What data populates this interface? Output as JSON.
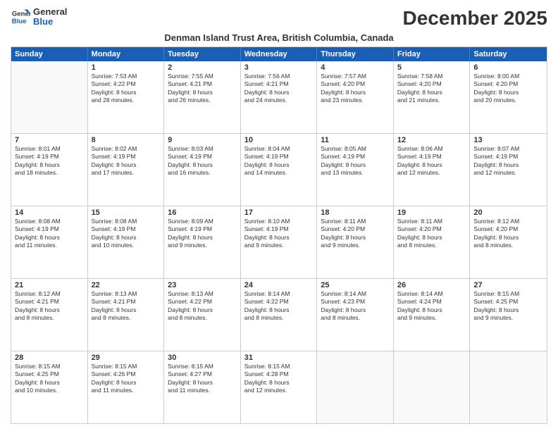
{
  "logo": {
    "line1": "General",
    "line2": "Blue"
  },
  "title": "December 2025",
  "subtitle": "Denman Island Trust Area, British Columbia, Canada",
  "header_days": [
    "Sunday",
    "Monday",
    "Tuesday",
    "Wednesday",
    "Thursday",
    "Friday",
    "Saturday"
  ],
  "weeks": [
    [
      {
        "day": "",
        "info": ""
      },
      {
        "day": "1",
        "info": "Sunrise: 7:53 AM\nSunset: 4:22 PM\nDaylight: 8 hours\nand 28 minutes."
      },
      {
        "day": "2",
        "info": "Sunrise: 7:55 AM\nSunset: 4:21 PM\nDaylight: 8 hours\nand 26 minutes."
      },
      {
        "day": "3",
        "info": "Sunrise: 7:56 AM\nSunset: 4:21 PM\nDaylight: 8 hours\nand 24 minutes."
      },
      {
        "day": "4",
        "info": "Sunrise: 7:57 AM\nSunset: 4:20 PM\nDaylight: 8 hours\nand 23 minutes."
      },
      {
        "day": "5",
        "info": "Sunrise: 7:58 AM\nSunset: 4:20 PM\nDaylight: 8 hours\nand 21 minutes."
      },
      {
        "day": "6",
        "info": "Sunrise: 8:00 AM\nSunset: 4:20 PM\nDaylight: 8 hours\nand 20 minutes."
      }
    ],
    [
      {
        "day": "7",
        "info": "Sunrise: 8:01 AM\nSunset: 4:19 PM\nDaylight: 8 hours\nand 18 minutes."
      },
      {
        "day": "8",
        "info": "Sunrise: 8:02 AM\nSunset: 4:19 PM\nDaylight: 8 hours\nand 17 minutes."
      },
      {
        "day": "9",
        "info": "Sunrise: 8:03 AM\nSunset: 4:19 PM\nDaylight: 8 hours\nand 16 minutes."
      },
      {
        "day": "10",
        "info": "Sunrise: 8:04 AM\nSunset: 4:19 PM\nDaylight: 8 hours\nand 14 minutes."
      },
      {
        "day": "11",
        "info": "Sunrise: 8:05 AM\nSunset: 4:19 PM\nDaylight: 8 hours\nand 13 minutes."
      },
      {
        "day": "12",
        "info": "Sunrise: 8:06 AM\nSunset: 4:19 PM\nDaylight: 8 hours\nand 12 minutes."
      },
      {
        "day": "13",
        "info": "Sunrise: 8:07 AM\nSunset: 4:19 PM\nDaylight: 8 hours\nand 12 minutes."
      }
    ],
    [
      {
        "day": "14",
        "info": "Sunrise: 8:08 AM\nSunset: 4:19 PM\nDaylight: 8 hours\nand 11 minutes."
      },
      {
        "day": "15",
        "info": "Sunrise: 8:08 AM\nSunset: 4:19 PM\nDaylight: 8 hours\nand 10 minutes."
      },
      {
        "day": "16",
        "info": "Sunrise: 8:09 AM\nSunset: 4:19 PM\nDaylight: 8 hours\nand 9 minutes."
      },
      {
        "day": "17",
        "info": "Sunrise: 8:10 AM\nSunset: 4:19 PM\nDaylight: 8 hours\nand 9 minutes."
      },
      {
        "day": "18",
        "info": "Sunrise: 8:11 AM\nSunset: 4:20 PM\nDaylight: 8 hours\nand 9 minutes."
      },
      {
        "day": "19",
        "info": "Sunrise: 8:11 AM\nSunset: 4:20 PM\nDaylight: 8 hours\nand 8 minutes."
      },
      {
        "day": "20",
        "info": "Sunrise: 8:12 AM\nSunset: 4:20 PM\nDaylight: 8 hours\nand 8 minutes."
      }
    ],
    [
      {
        "day": "21",
        "info": "Sunrise: 8:12 AM\nSunset: 4:21 PM\nDaylight: 8 hours\nand 8 minutes."
      },
      {
        "day": "22",
        "info": "Sunrise: 8:13 AM\nSunset: 4:21 PM\nDaylight: 8 hours\nand 8 minutes."
      },
      {
        "day": "23",
        "info": "Sunrise: 8:13 AM\nSunset: 4:22 PM\nDaylight: 8 hours\nand 8 minutes."
      },
      {
        "day": "24",
        "info": "Sunrise: 8:14 AM\nSunset: 4:22 PM\nDaylight: 8 hours\nand 8 minutes."
      },
      {
        "day": "25",
        "info": "Sunrise: 8:14 AM\nSunset: 4:23 PM\nDaylight: 8 hours\nand 8 minutes."
      },
      {
        "day": "26",
        "info": "Sunrise: 8:14 AM\nSunset: 4:24 PM\nDaylight: 8 hours\nand 9 minutes."
      },
      {
        "day": "27",
        "info": "Sunrise: 8:15 AM\nSunset: 4:25 PM\nDaylight: 8 hours\nand 9 minutes."
      }
    ],
    [
      {
        "day": "28",
        "info": "Sunrise: 8:15 AM\nSunset: 4:25 PM\nDaylight: 8 hours\nand 10 minutes."
      },
      {
        "day": "29",
        "info": "Sunrise: 8:15 AM\nSunset: 4:26 PM\nDaylight: 8 hours\nand 11 minutes."
      },
      {
        "day": "30",
        "info": "Sunrise: 8:15 AM\nSunset: 4:27 PM\nDaylight: 8 hours\nand 11 minutes."
      },
      {
        "day": "31",
        "info": "Sunrise: 8:15 AM\nSunset: 4:28 PM\nDaylight: 8 hours\nand 12 minutes."
      },
      {
        "day": "",
        "info": ""
      },
      {
        "day": "",
        "info": ""
      },
      {
        "day": "",
        "info": ""
      }
    ]
  ]
}
